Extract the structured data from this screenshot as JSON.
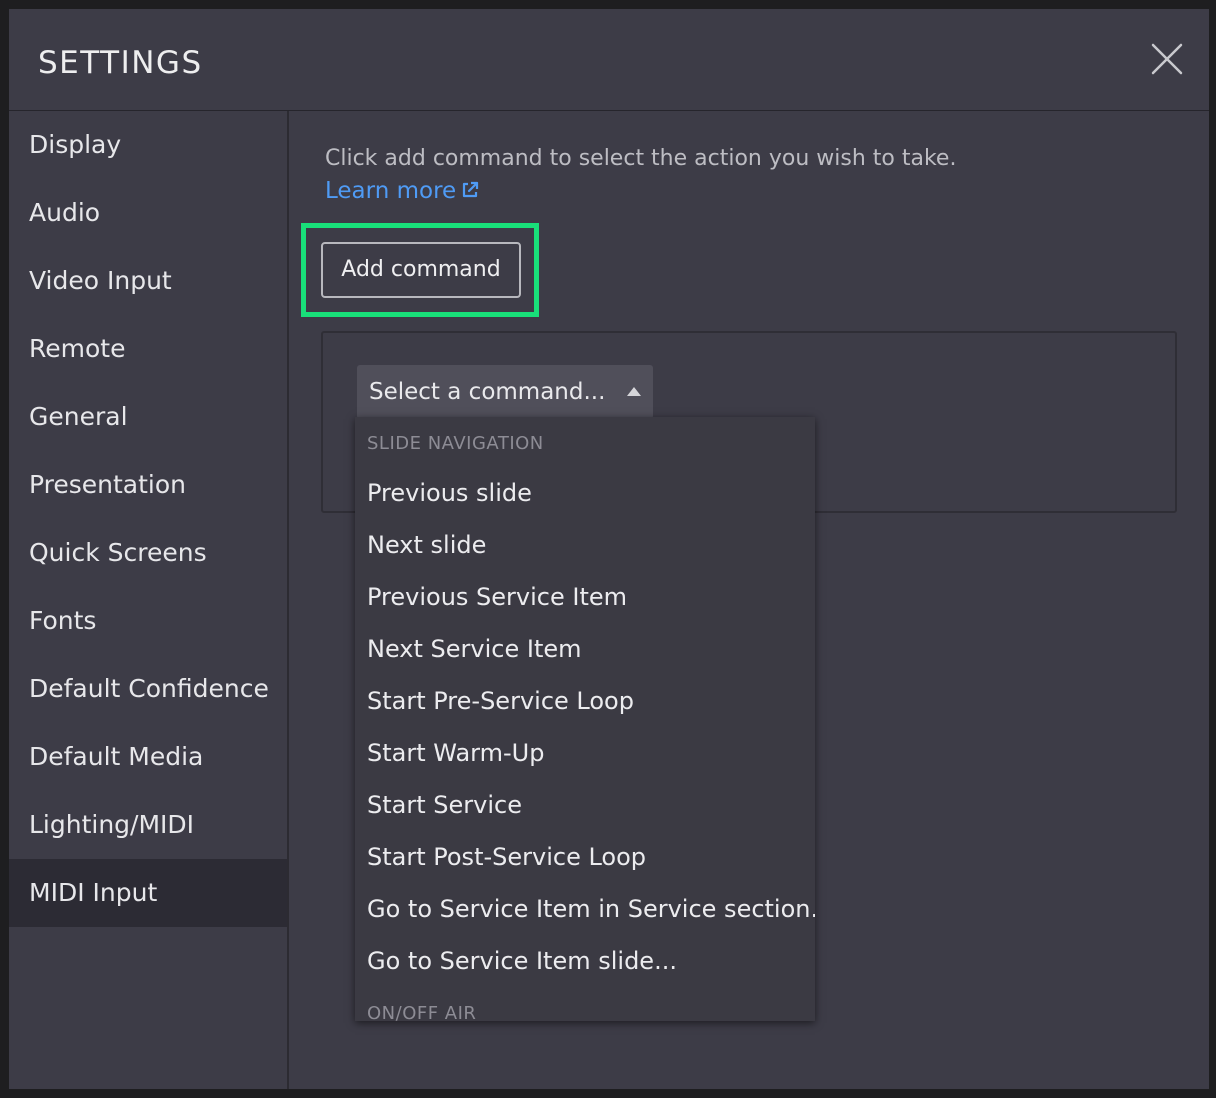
{
  "dialog": {
    "title": "SETTINGS"
  },
  "sidebar": {
    "items": [
      {
        "label": "Display"
      },
      {
        "label": "Audio"
      },
      {
        "label": "Video Input"
      },
      {
        "label": "Remote"
      },
      {
        "label": "General"
      },
      {
        "label": "Presentation"
      },
      {
        "label": "Quick Screens"
      },
      {
        "label": "Fonts"
      },
      {
        "label": "Default Confidence"
      },
      {
        "label": "Default Media"
      },
      {
        "label": "Lighting/MIDI"
      },
      {
        "label": "MIDI Input"
      }
    ],
    "active": "MIDI Input"
  },
  "content": {
    "hint": "Click add command to select the action you wish to take.",
    "learn_more": "Learn more",
    "add_command_label": "Add command",
    "select": {
      "selected": "Select a command..."
    },
    "dropdown": {
      "group_slide_navigation": "SLIDE NAVIGATION",
      "items": [
        "Previous slide",
        "Next slide",
        "Previous Service Item",
        "Next Service Item",
        "Start Pre-Service Loop",
        "Start Warm-Up",
        "Start Service",
        "Start Post-Service Loop",
        "Go to Service Item in Service section...",
        "Go to Service Item slide..."
      ],
      "group_on_off_air": "ON/OFF AIR"
    }
  },
  "colors": {
    "dialog_bg": "#3d3c47",
    "active_item_bg": "#2c2b34",
    "link": "#4f9bf5",
    "highlight": "#19e07a"
  }
}
